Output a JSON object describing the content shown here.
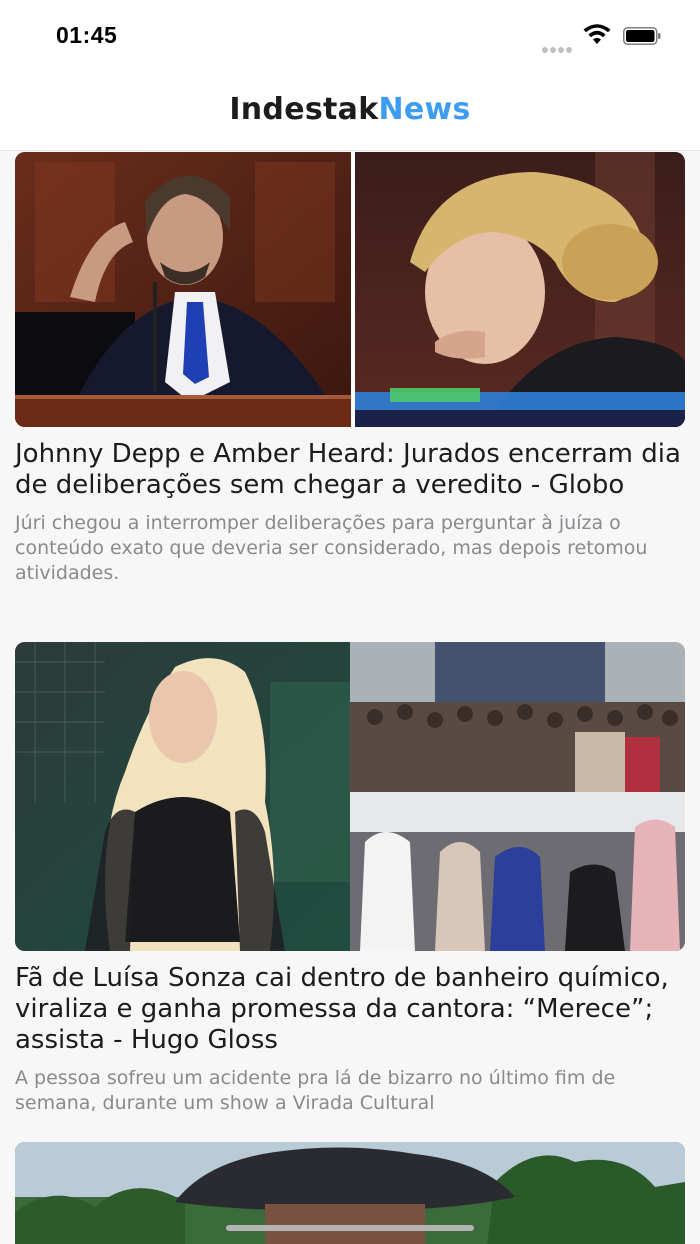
{
  "status_bar": {
    "time": "01:45",
    "icons": [
      "cellular-signal-icon",
      "wifi-icon",
      "battery-icon"
    ]
  },
  "header": {
    "brand_part1": "Indestak",
    "brand_part2": "News",
    "brand_accent_color": "#3d9cf0"
  },
  "articles": [
    {
      "headline": "Johnny Depp e Amber Heard: Jurados encerram dia de deliberações sem chegar a veredito - Globo",
      "summary": "Júri chegou a interromper deliberações para perguntar à juíza o conteúdo exato que deveria ser considerado, mas depois retomou atividades."
    },
    {
      "headline": "Fã de Luísa Sonza cai dentro de banheiro químico, viraliza e ganha promessa da cantora: “Merece”; assista - Hugo Gloss",
      "summary": "A pessoa sofreu um acidente pra lá de bizarro no último fim de semana, durante um show a Virada Cultural"
    },
    {
      "headline": "",
      "summary": ""
    }
  ]
}
